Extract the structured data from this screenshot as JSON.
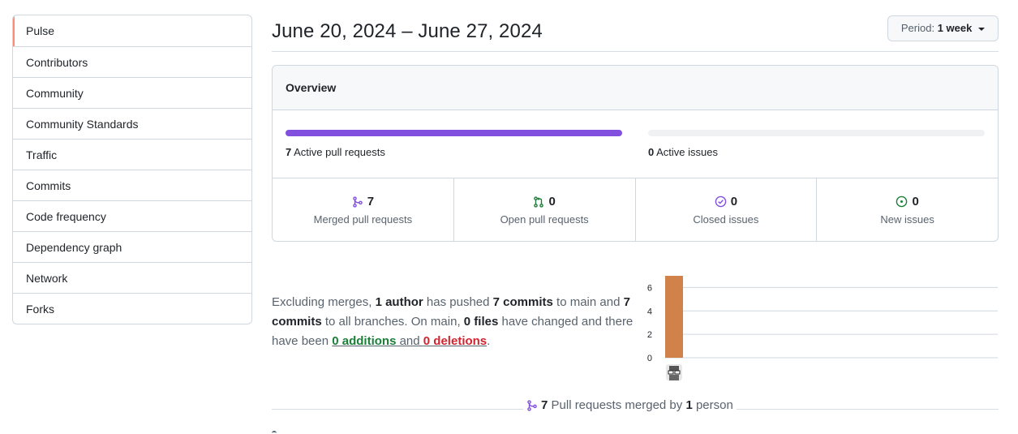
{
  "sidebar": {
    "items": [
      {
        "label": "Pulse"
      },
      {
        "label": "Contributors"
      },
      {
        "label": "Community"
      },
      {
        "label": "Community Standards"
      },
      {
        "label": "Traffic"
      },
      {
        "label": "Commits"
      },
      {
        "label": "Code frequency"
      },
      {
        "label": "Dependency graph"
      },
      {
        "label": "Network"
      },
      {
        "label": "Forks"
      }
    ],
    "selected_index": 0,
    "selected_color": "#fd8c73"
  },
  "header": {
    "title": "June 20, 2024 – June 27, 2024",
    "period_prefix": "Period:",
    "period_value": "1 week"
  },
  "overview": {
    "title": "Overview",
    "pull_requests": {
      "count": "7",
      "label": "Active pull requests",
      "fill_fraction": 1.0,
      "color": "#8250df"
    },
    "issues": {
      "count": "0",
      "label": "Active issues",
      "fill_fraction": 0.0
    },
    "stats": [
      {
        "value": "7",
        "label": "Merged pull requests",
        "icon": "git-merge-icon",
        "color": "#8250df"
      },
      {
        "value": "0",
        "label": "Open pull requests",
        "icon": "git-pull-request-icon",
        "color": "#1a7f37"
      },
      {
        "value": "0",
        "label": "Closed issues",
        "icon": "issue-closed-icon",
        "color": "#8250df"
      },
      {
        "value": "0",
        "label": "New issues",
        "icon": "issue-opened-icon",
        "color": "#1a7f37"
      }
    ]
  },
  "summary": {
    "t1": "Excluding merges, ",
    "authors": "1 author",
    "t2": " has pushed ",
    "commits_main": "7 commits",
    "t3": " to main and ",
    "commits_all": "7 commits",
    "t4": " to all branches. On main, ",
    "files": "0 files",
    "t5": " have changed and there have been ",
    "additions": "0 additions",
    "t6": " and ",
    "deletions": "0 deletions",
    "t7": "."
  },
  "chart_data": {
    "type": "bar",
    "categories": [
      "author-avatar"
    ],
    "values": [
      7
    ],
    "yticks": [
      "0",
      "2",
      "4",
      "6"
    ],
    "ylim": [
      0,
      7
    ],
    "grid": true,
    "bar_color": "#d1814a",
    "title": "",
    "xlabel": "",
    "ylabel": ""
  },
  "bottom": {
    "count": "7",
    "t1": " Pull requests merged by ",
    "people": "1",
    "t2": " person"
  }
}
